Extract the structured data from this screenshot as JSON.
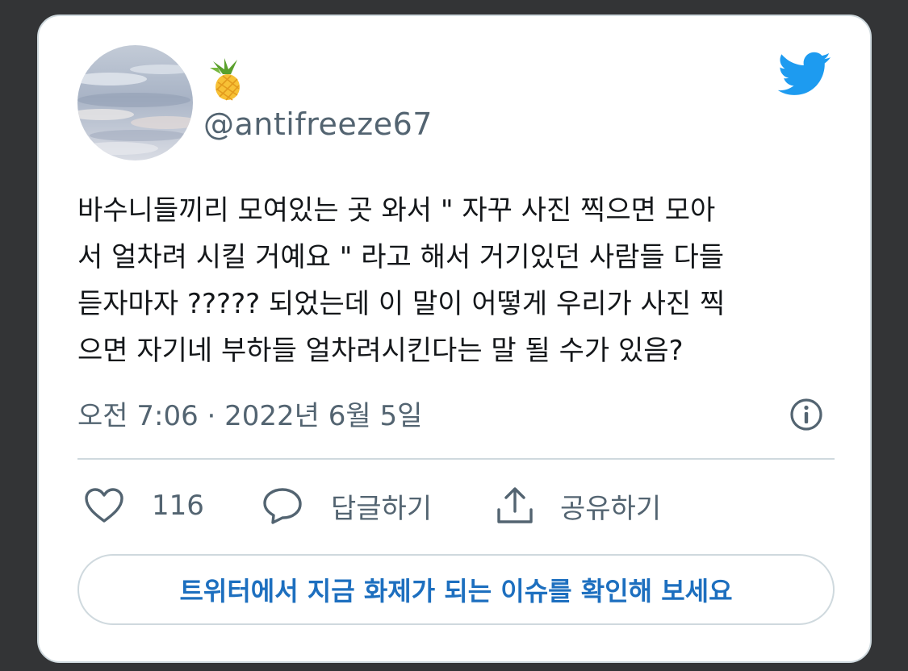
{
  "tweet": {
    "display_name_emoji": "🍍",
    "handle": "@antifreeze67",
    "text": "바수니들끼리 모여있는 곳 와서 \" 자꾸 사진 찍으면 모아\n서 얼차려 시킬 거예요 \" 라고 해서 거기있던 사람들 다들\n듣자마자 ????? 되었는데 이 말이 어떻게 우리가 사진 찍\n으면 자기네 부하들 얼차려시킨다는 말 될 수가 있음?",
    "timestamp": "오전 7:06 · 2022년 6월 5일"
  },
  "actions": {
    "like_count": "116",
    "reply_label": "답글하기",
    "share_label": "공유하기"
  },
  "cta": {
    "label": "트위터에서 지금 화제가 되는 이슈를 확인해 보세요"
  },
  "icons": {
    "brand": "twitter-bird-icon",
    "info": "info-icon",
    "like": "heart-icon",
    "reply": "speech-bubble-icon",
    "share": "share-upload-icon"
  },
  "colors": {
    "brand_blue": "#1d9bf0",
    "link_blue": "#1d6fbf",
    "secondary_text": "#536471",
    "border": "#cfd9de",
    "page_background": "#333436"
  }
}
